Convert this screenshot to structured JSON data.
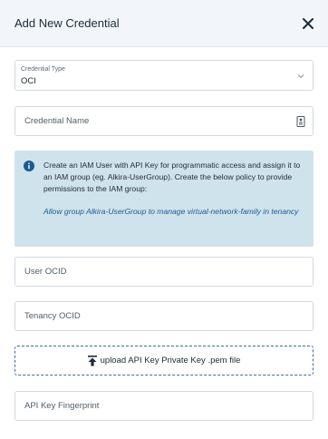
{
  "dialog": {
    "title": "Add New Credential",
    "close_icon": "close-icon"
  },
  "credential_type": {
    "label": "Credential Type",
    "value": "OCI",
    "icon": "chevron-down-icon"
  },
  "credential_name": {
    "placeholder": "Credential Name",
    "icon": "id-card-icon"
  },
  "info_box": {
    "icon": "info-icon",
    "text": "Create an IAM User with API Key for programmatic access and assign it to an IAM group (eg. Alkira-UserGroup). Create the below policy to provide permissions to the IAM group:",
    "policy": "Allow group Alkira-UserGroup to manage virtual-network-family in tenancy",
    "background": "#cfe3ec",
    "policy_color": "#1c5a91"
  },
  "user_ocid": {
    "placeholder": "User OCID"
  },
  "tenancy_ocid": {
    "placeholder": "Tenancy OCID"
  },
  "upload": {
    "label": "upload API Key Private Key .pem file",
    "icon": "upload-icon"
  },
  "api_key_fingerprint": {
    "placeholder": "API Key Fingerprint"
  }
}
